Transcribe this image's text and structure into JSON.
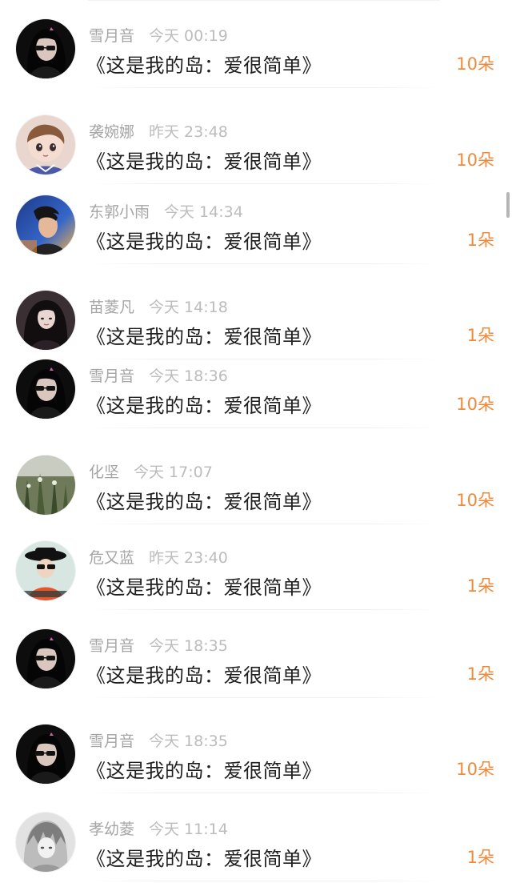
{
  "items": [
    {
      "name": "雪月音",
      "time": "今天 00:19",
      "title": "《这是我的岛：爱很简单》",
      "count": "10朵",
      "avatar": "avatar-girl-sunglasses"
    },
    {
      "name": "袭婉娜",
      "time": "昨天 23:48",
      "title": "《这是我的岛：爱很简单》",
      "count": "10朵",
      "avatar": "avatar-cartoon-girl"
    },
    {
      "name": "东郭小雨",
      "time": "今天 14:34",
      "title": "《这是我的岛：爱很简单》",
      "count": "1朵",
      "avatar": "avatar-boy-blue"
    },
    {
      "name": "苗菱凡",
      "time": "今天 14:18",
      "title": "《这是我的岛：爱很简单》",
      "count": "1朵",
      "avatar": "avatar-girl-dark"
    },
    {
      "name": "雪月音",
      "time": "今天 18:36",
      "title": "《这是我的岛：爱很简单》",
      "count": "10朵",
      "avatar": "avatar-girl-sunglasses"
    },
    {
      "name": "化坚",
      "time": "今天 17:07",
      "title": "《这是我的岛：爱很简单》",
      "count": "10朵",
      "avatar": "avatar-plant"
    },
    {
      "name": "危又蓝",
      "time": "昨天 23:40",
      "title": "《这是我的岛：爱很简单》",
      "count": "1朵",
      "avatar": "avatar-girl-hat"
    },
    {
      "name": "雪月音",
      "time": "今天 18:35",
      "title": "《这是我的岛：爱很简单》",
      "count": "1朵",
      "avatar": "avatar-girl-sunglasses"
    },
    {
      "name": "雪月音",
      "time": "今天 18:35",
      "title": "《这是我的岛：爱很简单》",
      "count": "10朵",
      "avatar": "avatar-girl-sunglasses"
    },
    {
      "name": "孝幼菱",
      "time": "今天 11:14",
      "title": "《这是我的岛：爱很简单》",
      "count": "1朵",
      "avatar": "avatar-anime-gray"
    }
  ],
  "colors": {
    "accent": "#f08a3a",
    "name": "#a5a5a5",
    "title": "#1f1f1f"
  }
}
